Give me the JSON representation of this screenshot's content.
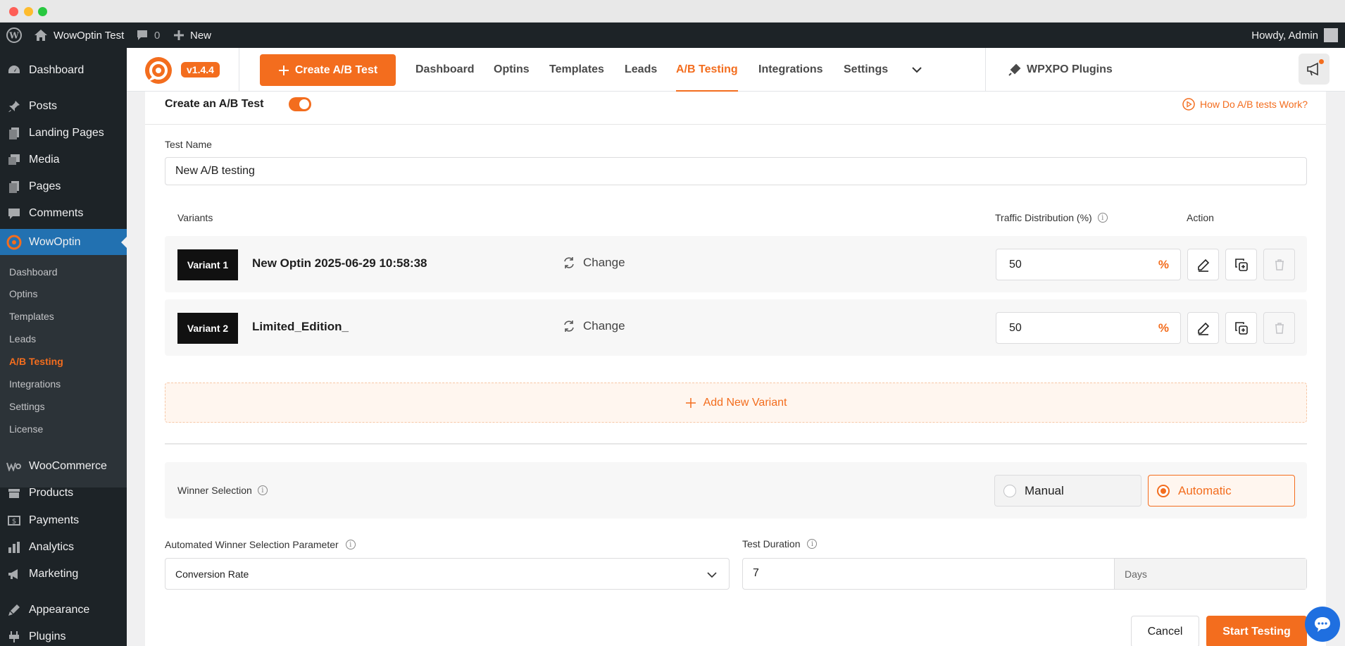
{
  "admin_bar": {
    "site_name": "WowOptin Test",
    "comments_count": "0",
    "new_label": "New",
    "howdy": "Howdy, Admin"
  },
  "sidebar": {
    "items": [
      {
        "label": "Dashboard",
        "icon": "dashboard-icon"
      },
      {
        "label": "Posts",
        "icon": "pin-icon"
      },
      {
        "label": "Landing Pages",
        "icon": "pages-icon"
      },
      {
        "label": "Media",
        "icon": "media-icon"
      },
      {
        "label": "Pages",
        "icon": "page-icon"
      },
      {
        "label": "Comments",
        "icon": "comment-icon"
      },
      {
        "label": "WowOptin",
        "icon": "wowoptin-icon"
      },
      {
        "label": "WooCommerce",
        "icon": "woo-icon"
      },
      {
        "label": "Products",
        "icon": "products-icon"
      },
      {
        "label": "Payments",
        "icon": "payments-icon"
      },
      {
        "label": "Analytics",
        "icon": "analytics-icon"
      },
      {
        "label": "Marketing",
        "icon": "marketing-icon"
      },
      {
        "label": "Appearance",
        "icon": "appearance-icon"
      },
      {
        "label": "Plugins",
        "icon": "plugins-icon"
      }
    ],
    "submenu": [
      "Dashboard",
      "Optins",
      "Templates",
      "Leads",
      "A/B Testing",
      "Integrations",
      "Settings",
      "License"
    ]
  },
  "header": {
    "version": "v1.4.4",
    "create_button": "Create A/B Test",
    "nav": [
      "Dashboard",
      "Optins",
      "Templates",
      "Leads",
      "A/B Testing",
      "Integrations",
      "Settings"
    ],
    "active_nav": "A/B Testing",
    "plugins_link": "WPXPO Plugins"
  },
  "form": {
    "title": "Create an A/B Test",
    "toggle_on": true,
    "help_link": "How Do A/B tests Work?",
    "test_name_label": "Test Name",
    "test_name_value": "New A/B testing",
    "variants_header": "Variants",
    "traffic_header": "Traffic Distribution (%)",
    "action_header": "Action",
    "variants": [
      {
        "tag": "Variant 1",
        "name": "New Optin 2025-06-29 10:58:38",
        "change": "Change",
        "traffic": "50",
        "unit": "%"
      },
      {
        "tag": "Variant 2",
        "name": "Limited_Edition_",
        "change": "Change",
        "traffic": "50",
        "unit": "%"
      }
    ],
    "add_variant": "Add New Variant",
    "winner_label": "Winner Selection",
    "winner_options": [
      "Manual",
      "Automatic"
    ],
    "winner_selected": "Automatic",
    "param_label": "Automated Winner Selection Parameter",
    "param_value": "Conversion Rate",
    "duration_label": "Test Duration",
    "duration_value": "7",
    "duration_unit": "Days",
    "cancel": "Cancel",
    "start": "Start Testing"
  },
  "colors": {
    "accent": "#f36d1e",
    "wp_dark": "#1d2327",
    "wp_blue": "#2271b1"
  }
}
